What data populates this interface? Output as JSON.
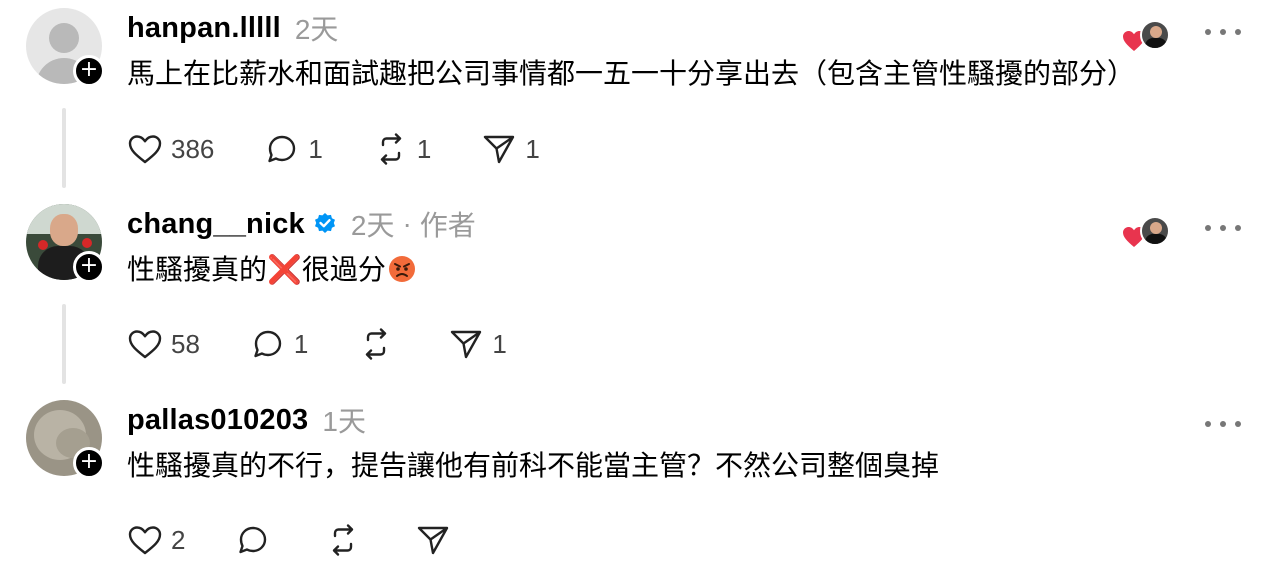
{
  "posts": [
    {
      "username": "hanpan.lllll",
      "time": "2天",
      "text": "馬上在比薪水和面試趣把公司事情都一五一十分享出去（包含主管性騷擾的部分）",
      "likes": "386",
      "replies": "1",
      "reposts": "1",
      "shares": "1"
    },
    {
      "username": "chang__nick",
      "time": "2天",
      "separator": "·",
      "author_tag": "作者",
      "text_before": "性騷擾真的",
      "text_emoji": "❌",
      "text_after": "很過分",
      "likes": "58",
      "replies": "1",
      "reposts": "",
      "shares": "1"
    },
    {
      "username": "pallas010203",
      "time": "1天",
      "text": "性騷擾真的不行，提告讓他有前科不能當主管？不然公司整個臭掉",
      "likes": "2",
      "replies": "",
      "reposts": "",
      "shares": ""
    }
  ],
  "follow_symbol": "+",
  "colors": {
    "like_heart": "#e8344e",
    "verified": "#0095f6",
    "muted_text": "#9a9a9a",
    "thread_line": "#e3e3e3"
  },
  "icons": [
    "heart-icon",
    "comment-icon",
    "repost-icon",
    "share-icon",
    "more-icon",
    "verified-icon",
    "angry-face-emoji"
  ]
}
